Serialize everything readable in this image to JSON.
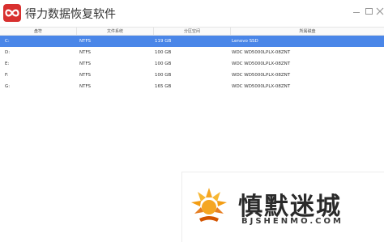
{
  "app": {
    "title": "得力数据恢复软件",
    "logo_icon": "infinity-icon",
    "accent_color": "#d8302f"
  },
  "window_controls": {
    "minimize_icon": "minimize-icon",
    "maximize_icon": "maximize-icon",
    "close_icon": "close-icon"
  },
  "table": {
    "columns": [
      "盘符",
      "文件系统",
      "分区空间",
      "所属磁盘"
    ],
    "selected_row_color": "#4a86e8",
    "rows": [
      {
        "drive": "C:",
        "fs": "NTFS",
        "size": "119 GB",
        "disk": "Lenovo SSD",
        "selected": true
      },
      {
        "drive": "D:",
        "fs": "NTFS",
        "size": "100 GB",
        "disk": "WDC WD5000LPLX-08ZNT",
        "selected": false
      },
      {
        "drive": "E:",
        "fs": "NTFS",
        "size": "100 GB",
        "disk": "WDC WD5000LPLX-08ZNT",
        "selected": false
      },
      {
        "drive": "F:",
        "fs": "NTFS",
        "size": "100 GB",
        "disk": "WDC WD5000LPLX-08ZNT",
        "selected": false
      },
      {
        "drive": "G:",
        "fs": "NTFS",
        "size": "165 GB",
        "disk": "WDC WD5000LPLX-08ZNT",
        "selected": false
      }
    ]
  },
  "watermark": {
    "name": "慎默迷城",
    "domain": "BJSHENMO.COM",
    "logo_icon": "sun-logo-icon"
  }
}
